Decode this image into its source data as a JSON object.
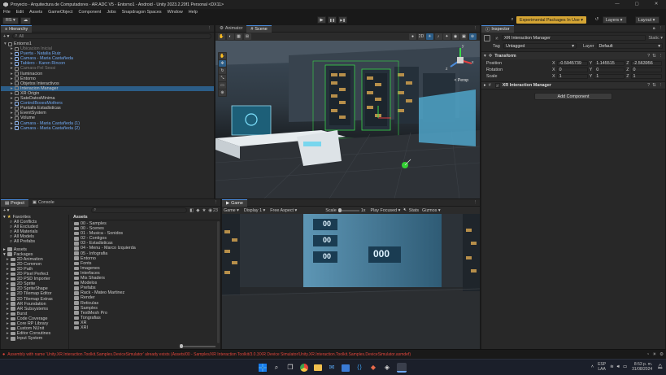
{
  "titlebar": {
    "title": "Proyecto - Arquitectura de Computadores - AR ADC V5 - Entorno1 - Android - Unity 2023.2.20f1 Personal <DX11>",
    "minimize": "—",
    "maximize": "▢",
    "close": "✕"
  },
  "menubar": [
    "File",
    "Edit",
    "Assets",
    "GameObject",
    "Component",
    "Jobs",
    "Snapdragon Spaces",
    "Window",
    "Help"
  ],
  "toolbar": {
    "account": "RS ▾",
    "cloud": "☁",
    "play": "▶",
    "pause": "❚❚",
    "step": "▶❚",
    "experimental": "Experimental Packages In Use ▾",
    "layers": "Layers ▾",
    "layout": "Layout ▾"
  },
  "hierarchy": {
    "tab": "Hierarchy",
    "search_placeholder": "All",
    "items": [
      {
        "label": "Entorno1",
        "indent": 0,
        "blue": false,
        "dim": false
      },
      {
        "label": "Ubicacion Inicial",
        "indent": 1,
        "blue": false,
        "dim": true
      },
      {
        "label": "Puerta - Natalia Ruiz",
        "indent": 1,
        "blue": true,
        "dim": false
      },
      {
        "label": "Camara - Maria Castañeda",
        "indent": 1,
        "blue": true,
        "dim": false
      },
      {
        "label": "Tablero - Karen Rincon",
        "indent": 1,
        "blue": true,
        "dim": false
      },
      {
        "label": "Camara-Fel Sessi",
        "indent": 1,
        "blue": false,
        "dim": true
      },
      {
        "label": "Iluminacion",
        "indent": 1,
        "blue": false,
        "dim": false
      },
      {
        "label": "Entorno",
        "indent": 1,
        "blue": false,
        "dim": false
      },
      {
        "label": "Objetos Interactivos",
        "indent": 1,
        "blue": false,
        "dim": false
      },
      {
        "label": "Interacion Manager",
        "indent": 1,
        "blue": false,
        "dim": false,
        "selected": true
      },
      {
        "label": "XR Origin",
        "indent": 1,
        "blue": false,
        "dim": false
      },
      {
        "label": "SateDatosMinima",
        "indent": 1,
        "blue": false,
        "dim": false
      },
      {
        "label": "ControlBoxesMothers",
        "indent": 1,
        "blue": true,
        "dim": false
      },
      {
        "label": "Pantalla Estadisticas",
        "indent": 1,
        "blue": false,
        "dim": false
      },
      {
        "label": "EventSystem",
        "indent": 1,
        "blue": false,
        "dim": false
      },
      {
        "label": "Volume",
        "indent": 1,
        "blue": false,
        "dim": false
      },
      {
        "label": "Camara - Maria Castañeda (1)",
        "indent": 1,
        "blue": true,
        "dim": false
      },
      {
        "label": "Camara - Maria Castañeda (2)",
        "indent": 1,
        "blue": true,
        "dim": false
      }
    ]
  },
  "scene": {
    "tabs": [
      "Animator",
      "Scene"
    ],
    "persp": "< Persp",
    "toolbar_2d": "2D",
    "gizmo_x": "x",
    "gizmo_y": "y",
    "gizmo_z": "z"
  },
  "inspector": {
    "tab": "Inspector",
    "object_name": "XR Interaction Manager",
    "static_label": "Static ▾",
    "tag_label": "Tag",
    "tag_value": "Untagged",
    "layer_label": "Layer",
    "layer_value": "Default",
    "transform": {
      "title": "Transform",
      "rows": [
        {
          "label": "Position",
          "x": "-0.5945739",
          "y": "1.145515",
          "z": "-2.563956"
        },
        {
          "label": "Rotation",
          "x": "0",
          "y": "0",
          "z": "0"
        },
        {
          "label": "Scale",
          "x": "1",
          "y": "1",
          "z": "1"
        }
      ]
    },
    "component_title": "XR Interaction Manager",
    "add_component": "Add Component"
  },
  "project": {
    "tabs": [
      "Project",
      "Console"
    ],
    "add": "+ ▾",
    "count": "23",
    "favorites": [
      "All Conflicts",
      "All Excluded",
      "All Materials",
      "All Models",
      "All Prefabs"
    ],
    "favorites_header": "Favorites",
    "assets_header": "Assets",
    "packages_header": "Packages",
    "packages": [
      "2D Animation",
      "2D Common",
      "2D Path",
      "2D Pixel Perfect",
      "2D PSD Importer",
      "2D Sprite",
      "2D SpriteShape",
      "2D Tilemap Editor",
      "2D Tilemap Extras",
      "AR Foundation",
      "AR Subsystems",
      "Burst",
      "Code Coverage",
      "Core RP Library",
      "Custom NUnit",
      "Editor Coroutines",
      "Input System"
    ],
    "breadcrumb": "Assets",
    "content": [
      "00 - Samples",
      "00 - Scenes",
      "01 - Musica - Sonidos",
      "02 - Contigos",
      "03 - Estadisticas",
      "04 - Menu - Marco Izquierda",
      "05 - Infografia",
      "Entorno",
      "Fonts",
      "Imagenes",
      "Interfaces",
      "Mis Shaders",
      "Modelos",
      "Prefabs",
      "Rack - Mateo Martinez",
      "Render",
      "Reticulas",
      "Samples",
      "TextMesh Pro",
      "Tongrafias",
      "XR",
      "XRI"
    ]
  },
  "game": {
    "tab": "Game",
    "display": "Game ▾",
    "display_num": "Display 1 ▾",
    "aspect": "Free Aspect ▾",
    "scale_label": "Scale",
    "scale_value": "1x",
    "play_mode": "Play Focused ▾",
    "stats": "Stats",
    "gizmos": "Gizmos ▾",
    "screen_values": [
      "00",
      "00",
      "00",
      "000"
    ]
  },
  "console_error": "Assembly with name 'Unity.XR.Interaction.Toolkit.Samples.DeviceSimulator' already exists (Assets/00 - Samples/XR Interaction Toolkit/3.0.3/XR Device Simulator/Unity.XR.Interaction.Toolkit.Samples.DeviceSimulator.asmdef)",
  "taskbar": {
    "language_top": "ESP",
    "language_bottom": "LAA",
    "time": "8:53 p. m.",
    "date": "31/08/2024"
  },
  "colors": {
    "accent": "#4a8ad8",
    "error": "#e0453c",
    "selection": "#2c5d87",
    "prefab_blue": "#6fa7f0"
  }
}
